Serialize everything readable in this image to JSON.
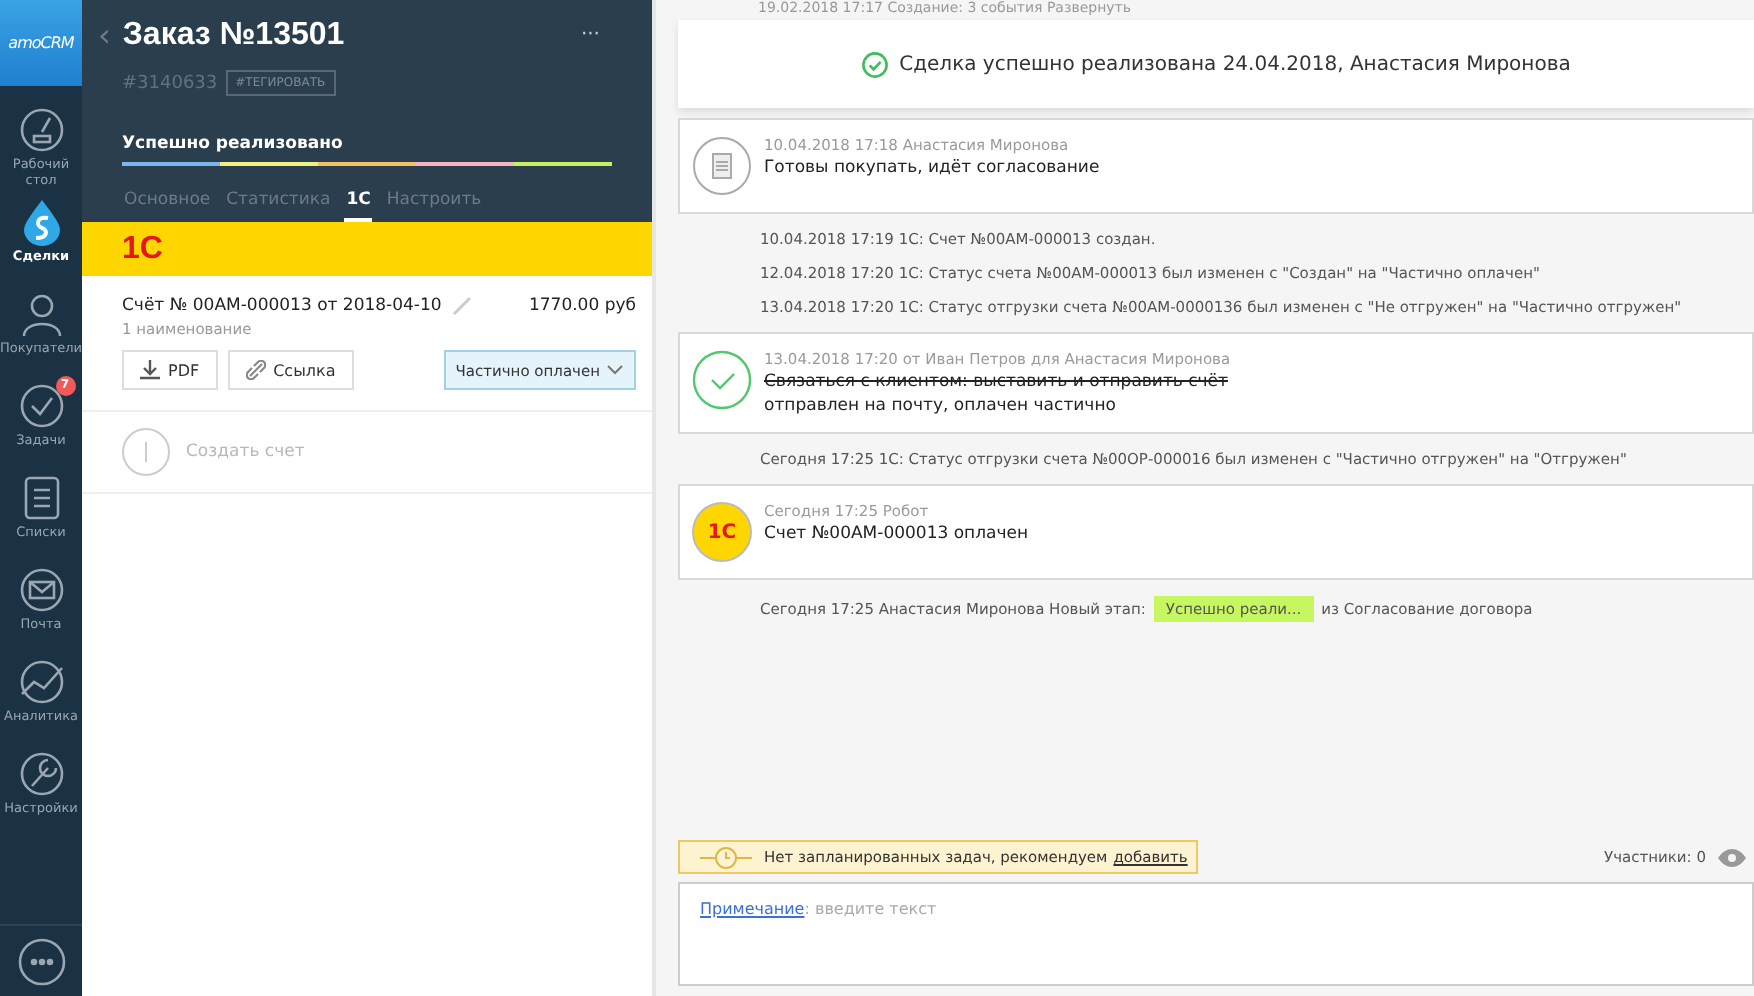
{
  "sidebar": {
    "logo": "amoCRM",
    "items": [
      {
        "label": "Рабочий стол",
        "selected": false
      },
      {
        "label": "Сделки",
        "selected": true
      },
      {
        "label": "Покупатели",
        "selected": false
      },
      {
        "label": "Задачи",
        "selected": false,
        "badge": "7"
      },
      {
        "label": "Списки",
        "selected": false
      },
      {
        "label": "Почта",
        "selected": false
      },
      {
        "label": "Аналитика",
        "selected": false
      },
      {
        "label": "Настройки",
        "selected": false
      }
    ]
  },
  "deal": {
    "back": "‹",
    "title": "Заказ №13501",
    "more": "···",
    "id": "#3140633",
    "tag_button": "#ТЕГИРОВАТЬ",
    "stage": "Успешно реализовано",
    "pipeline": [
      {
        "color": "#7ab6f0"
      },
      {
        "color": "#f2ee84"
      },
      {
        "color": "#f5c068"
      },
      {
        "color": "#f5b5c0"
      },
      {
        "color": "#c7ef5e"
      }
    ],
    "tabs": [
      {
        "label": "Основное",
        "selected": false
      },
      {
        "label": "Статистика",
        "selected": false
      },
      {
        "label": "1С",
        "selected": true
      },
      {
        "label": "Настроить",
        "selected": false
      }
    ],
    "integration_logo": "1С",
    "invoice": {
      "title": "Счёт № 00АМ-000013 от 2018-04-10",
      "amount": "1770.00 руб",
      "items": "1 наименование",
      "pdf_button": "PDF",
      "link_button": "Ссылка",
      "status": "Частично оплачен"
    },
    "create_invoice": "Создать счет"
  },
  "feed": {
    "collapsed_line": "19.02.2018 17:17 Создание: 3 события Развернуть",
    "banner": "Сделка успешно реализована 24.04.2018, Анастасия Миронова",
    "entries": [
      {
        "kind": "note",
        "meta": "10.04.2018 17:18 Анастасия Миронова",
        "text": "Готовы покупать, идёт согласование"
      },
      {
        "kind": "event",
        "text": "10.04.2018 17:19 1С: Счет №00АМ-000013 создан."
      },
      {
        "kind": "event",
        "text": "12.04.2018 17:20 1С: Статус счета №00АМ-000013 был изменен с \"Создан\" на \"Частично оплачен\""
      },
      {
        "kind": "event",
        "text": "13.04.2018 17:20 1С: Статус отгрузки счета №00АМ-0000136 был изменен с \"Не отгружен\" на \"Частично отгружен\""
      },
      {
        "kind": "task",
        "meta": "13.04.2018 17:20  от Иван Петров для Анастасия Миронова",
        "task": "Связаться с клиентом: выставить и отправить счёт",
        "done": true,
        "text": "отправлен на почту, оплачен частично"
      },
      {
        "kind": "event",
        "text": "Сегодня 17:25 1С: Статус отгрузки счета №00ОР-000016 был изменен с \"Частично отгружен\" на \"Отгружен\""
      },
      {
        "kind": "robot",
        "meta": "Сегодня 17:25 Робот",
        "logo": "1С",
        "text": "Счет №00АМ-000013 оплачен"
      },
      {
        "kind": "stage",
        "text": "Сегодня 17:25 Анастасия Миронова  Новый этап:",
        "stage": "Успешно реали...",
        "from": "из Согласование договора"
      }
    ],
    "task_hint": "Нет запланированных задач, рекомендуем",
    "task_link": "добавить",
    "participants": "Участники: 0",
    "note_label": "Примечание",
    "note_placeholder": ": введите текст"
  }
}
